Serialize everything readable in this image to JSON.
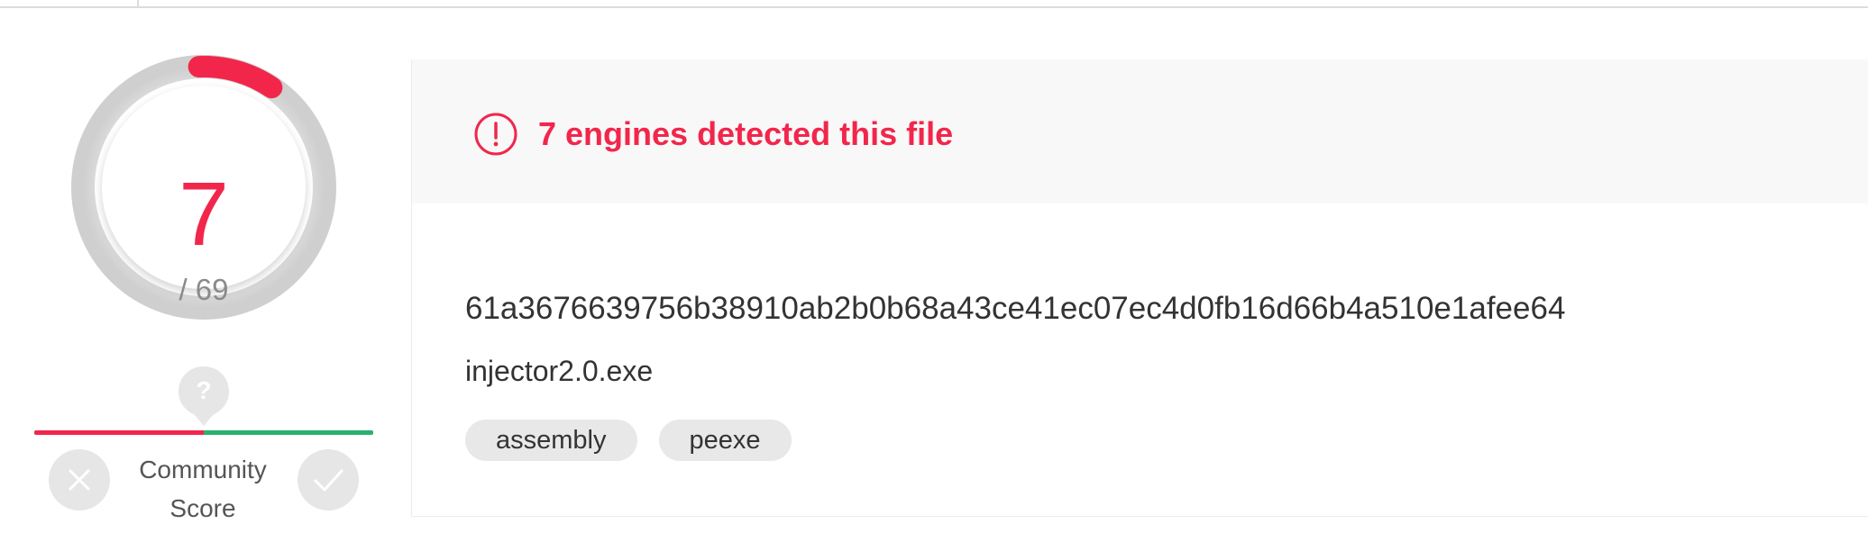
{
  "detection": {
    "malicious": "7",
    "total": "/ 69",
    "fraction": 0.1014,
    "alert_text": "7 engines detected this file"
  },
  "community": {
    "unknown_glyph": "?",
    "label_line1": "Community",
    "label_line2": "Score",
    "downvote_icon": "close-icon",
    "upvote_icon": "check-icon"
  },
  "file": {
    "hash": "61a3676639756b38910ab2b0b68a43ce41ec07ec4d0fb16d66b4a510e1afee64",
    "name": "injector2.0.exe",
    "tags": [
      "assembly",
      "peexe"
    ]
  },
  "colors": {
    "danger": "#f2264b",
    "positive": "#2ab06f",
    "muted": "#8a8a8a"
  }
}
